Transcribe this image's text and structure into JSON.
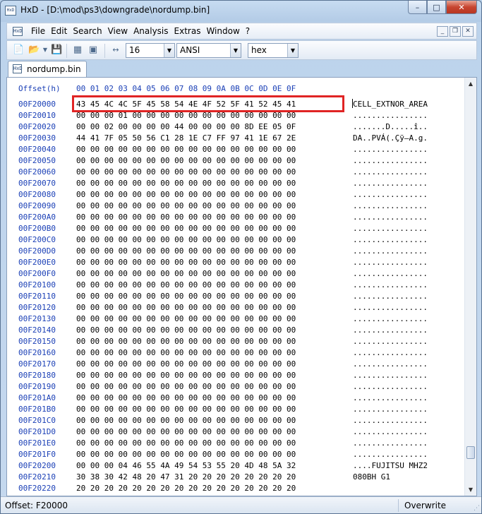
{
  "window": {
    "title": "HxD - [D:\\mod\\ps3\\downgrade\\nordump.bin]",
    "app_icon_text": "HxD",
    "minimize": "–",
    "maximize": "□",
    "close": "✕"
  },
  "menu": {
    "items": [
      "File",
      "Edit",
      "Search",
      "View",
      "Analysis",
      "Extras",
      "Window",
      "?"
    ],
    "mdi_minimize": "_",
    "mdi_restore": "❐",
    "mdi_close": "✕"
  },
  "toolbar": {
    "icons": [
      "new-file-icon",
      "open-folder-icon",
      "save-icon",
      "ram-icon",
      "disk-icon",
      "bytes-per-row-icon"
    ],
    "bytes_per_row": "16",
    "charset": "ANSI",
    "offset_base": "hex"
  },
  "tab": {
    "label": "nordump.bin"
  },
  "editor": {
    "header_label": "Offset(h)",
    "columns": [
      "00",
      "01",
      "02",
      "03",
      "04",
      "05",
      "06",
      "07",
      "08",
      "09",
      "0A",
      "0B",
      "0C",
      "0D",
      "0E",
      "0F"
    ],
    "rows": [
      {
        "offset": "00F20000",
        "hex": "43 45 4C 4C 5F 45 58 54 4E 4F 52 5F 41 52 45 41",
        "text": "CELL_EXTNOR_AREA"
      },
      {
        "offset": "00F20010",
        "hex": "00 00 00 01 00 00 00 00 00 00 00 00 00 00 00 00",
        "text": "................"
      },
      {
        "offset": "00F20020",
        "hex": "00 00 02 00 00 00 00 44 00 00 00 00 8D EE 05 0F",
        "text": ".......D.....î.."
      },
      {
        "offset": "00F20030",
        "hex": "44 41 7F 05 50 56 C1 28 1E C7 FF 97 41 1E 67 2E",
        "text": "DA..PVÁ(.Çÿ—A.g."
      },
      {
        "offset": "00F20040",
        "hex": "00 00 00 00 00 00 00 00 00 00 00 00 00 00 00 00",
        "text": "................"
      },
      {
        "offset": "00F20050",
        "hex": "00 00 00 00 00 00 00 00 00 00 00 00 00 00 00 00",
        "text": "................"
      },
      {
        "offset": "00F20060",
        "hex": "00 00 00 00 00 00 00 00 00 00 00 00 00 00 00 00",
        "text": "................"
      },
      {
        "offset": "00F20070",
        "hex": "00 00 00 00 00 00 00 00 00 00 00 00 00 00 00 00",
        "text": "................"
      },
      {
        "offset": "00F20080",
        "hex": "00 00 00 00 00 00 00 00 00 00 00 00 00 00 00 00",
        "text": "................"
      },
      {
        "offset": "00F20090",
        "hex": "00 00 00 00 00 00 00 00 00 00 00 00 00 00 00 00",
        "text": "................"
      },
      {
        "offset": "00F200A0",
        "hex": "00 00 00 00 00 00 00 00 00 00 00 00 00 00 00 00",
        "text": "................"
      },
      {
        "offset": "00F200B0",
        "hex": "00 00 00 00 00 00 00 00 00 00 00 00 00 00 00 00",
        "text": "................"
      },
      {
        "offset": "00F200C0",
        "hex": "00 00 00 00 00 00 00 00 00 00 00 00 00 00 00 00",
        "text": "................"
      },
      {
        "offset": "00F200D0",
        "hex": "00 00 00 00 00 00 00 00 00 00 00 00 00 00 00 00",
        "text": "................"
      },
      {
        "offset": "00F200E0",
        "hex": "00 00 00 00 00 00 00 00 00 00 00 00 00 00 00 00",
        "text": "................"
      },
      {
        "offset": "00F200F0",
        "hex": "00 00 00 00 00 00 00 00 00 00 00 00 00 00 00 00",
        "text": "................"
      },
      {
        "offset": "00F20100",
        "hex": "00 00 00 00 00 00 00 00 00 00 00 00 00 00 00 00",
        "text": "................"
      },
      {
        "offset": "00F20110",
        "hex": "00 00 00 00 00 00 00 00 00 00 00 00 00 00 00 00",
        "text": "................"
      },
      {
        "offset": "00F20120",
        "hex": "00 00 00 00 00 00 00 00 00 00 00 00 00 00 00 00",
        "text": "................"
      },
      {
        "offset": "00F20130",
        "hex": "00 00 00 00 00 00 00 00 00 00 00 00 00 00 00 00",
        "text": "................"
      },
      {
        "offset": "00F20140",
        "hex": "00 00 00 00 00 00 00 00 00 00 00 00 00 00 00 00",
        "text": "................"
      },
      {
        "offset": "00F20150",
        "hex": "00 00 00 00 00 00 00 00 00 00 00 00 00 00 00 00",
        "text": "................"
      },
      {
        "offset": "00F20160",
        "hex": "00 00 00 00 00 00 00 00 00 00 00 00 00 00 00 00",
        "text": "................"
      },
      {
        "offset": "00F20170",
        "hex": "00 00 00 00 00 00 00 00 00 00 00 00 00 00 00 00",
        "text": "................"
      },
      {
        "offset": "00F20180",
        "hex": "00 00 00 00 00 00 00 00 00 00 00 00 00 00 00 00",
        "text": "................"
      },
      {
        "offset": "00F20190",
        "hex": "00 00 00 00 00 00 00 00 00 00 00 00 00 00 00 00",
        "text": "................"
      },
      {
        "offset": "00F201A0",
        "hex": "00 00 00 00 00 00 00 00 00 00 00 00 00 00 00 00",
        "text": "................"
      },
      {
        "offset": "00F201B0",
        "hex": "00 00 00 00 00 00 00 00 00 00 00 00 00 00 00 00",
        "text": "................"
      },
      {
        "offset": "00F201C0",
        "hex": "00 00 00 00 00 00 00 00 00 00 00 00 00 00 00 00",
        "text": "................"
      },
      {
        "offset": "00F201D0",
        "hex": "00 00 00 00 00 00 00 00 00 00 00 00 00 00 00 00",
        "text": "................"
      },
      {
        "offset": "00F201E0",
        "hex": "00 00 00 00 00 00 00 00 00 00 00 00 00 00 00 00",
        "text": "................"
      },
      {
        "offset": "00F201F0",
        "hex": "00 00 00 00 00 00 00 00 00 00 00 00 00 00 00 00",
        "text": "................"
      },
      {
        "offset": "00F20200",
        "hex": "00 00 00 04 46 55 4A 49 54 53 55 20 4D 48 5A 32",
        "text": "....FUJITSU MHZ2"
      },
      {
        "offset": "00F20210",
        "hex": "30 38 30 42 48 20 47 31 20 20 20 20 20 20 20 20",
        "text": "080BH G1        "
      },
      {
        "offset": "00F20220",
        "hex": "20 20 20 20 20 20 20 20 20 20 20 20 20 20 20 20",
        "text": "                "
      }
    ]
  },
  "status": {
    "offset": "Offset: F20000",
    "mode": "Overwrite"
  }
}
